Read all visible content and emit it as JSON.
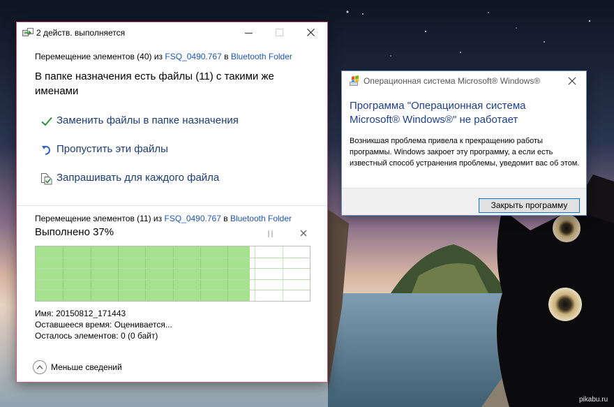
{
  "copy_dialog": {
    "title": "2 действ. выполняется",
    "op1": {
      "prefix": "Перемещение элементов (40) из",
      "source": "FSQ_0490.767",
      "mid": "в",
      "destination": "Bluetooth Folder"
    },
    "conflict_title": "В папке назначения есть файлы (11) с такими же именами",
    "options": [
      {
        "label": "Заменить файлы в папке назначения",
        "icon": "checkmark-icon"
      },
      {
        "label": "Пропустить эти файлы",
        "icon": "skip-arrow-icon"
      },
      {
        "label": "Запрашивать для каждого файла",
        "icon": "compare-files-icon"
      }
    ],
    "op2": {
      "prefix": "Перемещение элементов (11) из",
      "source": "FSQ_0490.767",
      "mid": "в",
      "destination": "Bluetooth Folder"
    },
    "progress_title": "Выполнено 37%",
    "progress_fraction": 0.78,
    "info": {
      "name_label": "Имя:",
      "name_value": "20150812_171443",
      "time_label": "Оставшееся время:",
      "time_value": "Оценивается...",
      "items_label": "Осталось элементов:",
      "items_value": "0 (0 байт)"
    },
    "less_details": "Меньше сведений"
  },
  "error_dialog": {
    "title": "Операционная система Microsoft® Windows®",
    "heading": "Программа \"Операционная система Microsoft® Windows®\" не работает",
    "body": "Возникшая проблема привела к прекращению работы программы. Windows закроет эту программу, а если есть известный способ устранения проблемы, уведомит вас об этом.",
    "close_button": "Закрыть программу"
  },
  "watermark": "pikabu.ru",
  "colors": {
    "progress_fill": "#a6e190",
    "link": "#1a56b4",
    "option_text": "#1b3c77",
    "check_green": "#2b8f3c",
    "error_heading": "#1d3f8f"
  }
}
